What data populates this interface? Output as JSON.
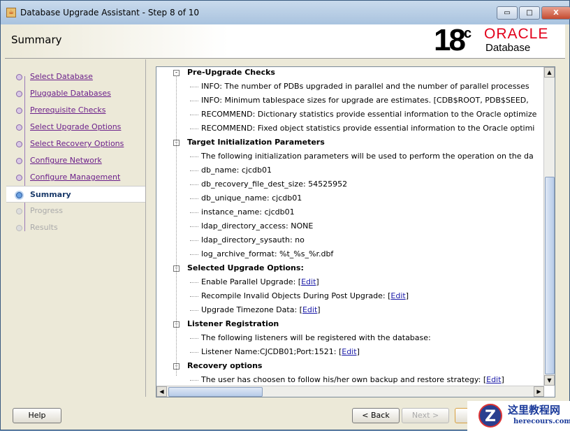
{
  "window": {
    "title": "Database Upgrade Assistant - Step 8 of 10",
    "min": "▭",
    "max": "□",
    "close": "X"
  },
  "header": {
    "title": "Summary",
    "logo_version": "18",
    "logo_sup": "c",
    "logo_brand": "ORACLE",
    "logo_product": "Database"
  },
  "steps": [
    {
      "label": "Select Database",
      "state": "done"
    },
    {
      "label": "Pluggable Databases",
      "state": "done"
    },
    {
      "label": "Prerequisite Checks",
      "state": "done"
    },
    {
      "label": "Select Upgrade Options",
      "state": "done"
    },
    {
      "label": "Select Recovery Options",
      "state": "done"
    },
    {
      "label": "Configure Network",
      "state": "done"
    },
    {
      "label": "Configure Management",
      "state": "done"
    },
    {
      "label": "Summary",
      "state": "current"
    },
    {
      "label": "Progress",
      "state": "future"
    },
    {
      "label": "Results",
      "state": "future"
    }
  ],
  "tree": [
    {
      "type": "h",
      "text": "Pre-Upgrade Checks"
    },
    {
      "type": "c",
      "text": "INFO: The number of PDBs upgraded in parallel and the number of parallel processes"
    },
    {
      "type": "c",
      "text": "INFO: Minimum tablespace sizes for upgrade are estimates. [CDB$ROOT, PDB$SEED,"
    },
    {
      "type": "c",
      "text": "RECOMMEND: Dictionary statistics provide essential information to the Oracle optimize"
    },
    {
      "type": "c",
      "text": "RECOMMEND: Fixed object statistics provide essential information to the Oracle optimi"
    },
    {
      "type": "h",
      "text": "Target Initialization Parameters"
    },
    {
      "type": "c",
      "text": "The following initialization parameters will be used to perform the operation on the da"
    },
    {
      "type": "c",
      "text": "db_name: cjcdb01"
    },
    {
      "type": "c",
      "text": "db_recovery_file_dest_size: 54525952"
    },
    {
      "type": "c",
      "text": "db_unique_name: cjcdb01"
    },
    {
      "type": "c",
      "text": "instance_name: cjcdb01"
    },
    {
      "type": "c",
      "text": "ldap_directory_access: NONE"
    },
    {
      "type": "c",
      "text": "ldap_directory_sysauth: no"
    },
    {
      "type": "c",
      "text": "log_archive_format: %t_%s_%r.dbf"
    },
    {
      "type": "h",
      "text": "Selected Upgrade Options:"
    },
    {
      "type": "c",
      "text": "Enable Parallel Upgrade: ",
      "link": "Edit"
    },
    {
      "type": "c",
      "text": "Recompile Invalid Objects During Post Upgrade: ",
      "link": "Edit"
    },
    {
      "type": "c",
      "text": "Upgrade Timezone Data: ",
      "link": "Edit"
    },
    {
      "type": "h",
      "text": "Listener Registration"
    },
    {
      "type": "c",
      "text": "The following listeners will be registered with the database:"
    },
    {
      "type": "c",
      "text": "Listener Name:CJCDB01;Port:1521: ",
      "link": "Edit"
    },
    {
      "type": "h",
      "text": "Recovery options"
    },
    {
      "type": "c",
      "text": "The user has choosen to follow his/her own backup and restore strategy: ",
      "link": "Edit"
    }
  ],
  "buttons": {
    "help": "Help",
    "back": "< Back",
    "next": "Next >"
  },
  "watermark": {
    "cn": "这里教程网",
    "url": "herecours.com"
  }
}
